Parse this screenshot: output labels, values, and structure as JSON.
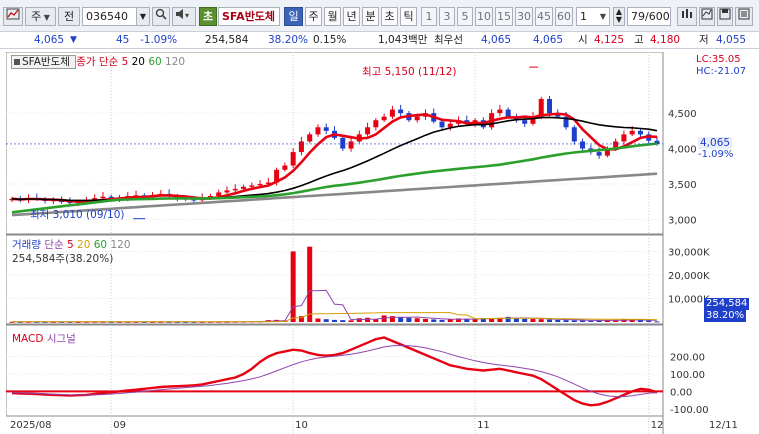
{
  "toolbar": {
    "market_short": "주",
    "mode": "전",
    "stock_code": "036540",
    "reset_label": "초",
    "stock_name": "SFA반도체",
    "periods": [
      "일",
      "주",
      "월",
      "년",
      "분",
      "초",
      "틱"
    ],
    "minute_options": [
      "1",
      "3",
      "5",
      "10",
      "15",
      "30",
      "45",
      "60"
    ],
    "interval_value": "1",
    "count_current": "79",
    "count_total": "/600"
  },
  "info": {
    "price": "4,065",
    "arrow": "▼",
    "change": "45",
    "change_pct": "-1.09%",
    "volume": "254,584",
    "volume_ratio": "38.20%",
    "turnover": "0.15%",
    "amount": "1,043백만",
    "mode_label": "최우선",
    "ask": "4,065",
    "bid": "4,065",
    "open_label": "시",
    "open": "4,125",
    "high_label": "고",
    "high": "4,180",
    "low_label": "저",
    "low": "4,055"
  },
  "price_panel": {
    "name_tag": "SFA반도체",
    "legend_title": "종가 단순",
    "ma_periods": [
      "5",
      "20",
      "60",
      "120"
    ],
    "lc_label": "LC:35.05",
    "hc_label": "HC:-21.07",
    "current_price": "4,065",
    "current_change": "-1.09%",
    "high_marker": "최고 5,150 (11/12)",
    "low_marker": "최저 3,010 (09/10)",
    "y_ticks": [
      "4,500",
      "4,000",
      "3,500",
      "3,000"
    ]
  },
  "volume_panel": {
    "legend_title": "거래량",
    "legend_type": "단순",
    "ma_periods": [
      "5",
      "20",
      "60",
      "120"
    ],
    "volume_text": "254,584주(38.20%)",
    "y_ticks": [
      "30,000K",
      "20,000K",
      "10,000K"
    ],
    "current_volume": "254,584",
    "current_ratio": "38.20%"
  },
  "macd_panel": {
    "legend_macd": "MACD",
    "legend_signal": "시그널",
    "y_ticks": [
      "200.00",
      "100.00",
      "0.00",
      "-100.00"
    ]
  },
  "x_axis": {
    "labels": [
      "2025/08",
      "09",
      "10",
      "11",
      "12",
      "12/11"
    ]
  },
  "chart_data": [
    {
      "type": "line",
      "title": "SFA반도체",
      "x_labels": [
        "2025/08",
        "09",
        "10",
        "11",
        "12"
      ],
      "close": [
        3290,
        3275,
        3300,
        3285,
        3260,
        3270,
        3245,
        3230,
        3250,
        3275,
        3300,
        3320,
        3280,
        3300,
        3330,
        3340,
        3320,
        3345,
        3360,
        3330,
        3300,
        3280,
        3270,
        3300,
        3330,
        3380,
        3410,
        3430,
        3460,
        3480,
        3500,
        3520,
        3700,
        3760,
        3950,
        4100,
        4200,
        4300,
        4250,
        4150,
        4000,
        4100,
        4200,
        4300,
        4400,
        4450,
        4550,
        4500,
        4400,
        4450,
        4500,
        4380,
        4300,
        4350,
        4400,
        4350,
        4400,
        4300,
        4500,
        4550,
        4450,
        4400,
        4350,
        4450,
        4700,
        4500,
        4450,
        4300,
        4100,
        4000,
        3950,
        3900,
        4000,
        4100,
        4200,
        4250,
        4200,
        4110,
        4065
      ],
      "ma_series": [
        {
          "name": "5",
          "color": "#e60012"
        },
        {
          "name": "20",
          "color": "#000000"
        },
        {
          "name": "60",
          "color": "#2ca02c"
        },
        {
          "name": "120",
          "color": "#888888"
        }
      ],
      "ylim": [
        2850,
        5250
      ],
      "high": {
        "value": 5150,
        "date": "11/12"
      },
      "low": {
        "value": 3010,
        "date": "09/10"
      }
    },
    {
      "type": "bar",
      "title": "거래량",
      "unit": "K",
      "values": [
        80,
        70,
        90,
        75,
        60,
        65,
        70,
        80,
        60,
        85,
        100,
        90,
        70,
        75,
        80,
        70,
        60,
        65,
        80,
        70,
        60,
        55,
        50,
        60,
        90,
        120,
        100,
        140,
        170,
        200,
        250,
        800,
        900,
        700,
        30000,
        2500,
        32000,
        1500,
        1200,
        900,
        800,
        700,
        1600,
        1800,
        1200,
        2800,
        2500,
        2000,
        1800,
        1600,
        1300,
        1100,
        900,
        1200,
        1500,
        1400,
        1200,
        1600,
        1500,
        1800,
        2200,
        1500,
        1400,
        1300,
        1200,
        1000,
        900,
        800,
        700,
        600,
        500,
        700,
        800,
        900,
        1000,
        800,
        700,
        600,
        254.584
      ],
      "ylim": [
        0,
        34000
      ]
    },
    {
      "type": "line",
      "title": "MACD",
      "series": [
        {
          "name": "MACD",
          "color": "#e60012",
          "values": [
            -10,
            -12,
            -13,
            -15,
            -18,
            -20,
            -22,
            -24,
            -22,
            -20,
            -15,
            -10,
            -5,
            0,
            5,
            10,
            15,
            20,
            25,
            28,
            30,
            32,
            35,
            40,
            50,
            60,
            70,
            80,
            100,
            130,
            170,
            200,
            220,
            230,
            240,
            235,
            220,
            210,
            205,
            210,
            220,
            240,
            260,
            280,
            300,
            310,
            290,
            270,
            250,
            230,
            210,
            190,
            170,
            150,
            140,
            130,
            125,
            120,
            125,
            130,
            120,
            110,
            100,
            90,
            70,
            40,
            10,
            -20,
            -50,
            -70,
            -80,
            -75,
            -60,
            -40,
            -20,
            0,
            15,
            10,
            -5
          ]
        },
        {
          "name": "시그널",
          "color": "#8e44ad",
          "values": [
            -5,
            -8,
            -10,
            -12,
            -14,
            -16,
            -18,
            -20,
            -21,
            -21,
            -20,
            -18,
            -15,
            -12,
            -8,
            -4,
            0,
            5,
            10,
            14,
            18,
            22,
            26,
            30,
            34,
            40,
            46,
            54,
            62,
            72,
            84,
            100,
            118,
            136,
            154,
            170,
            182,
            192,
            198,
            202,
            208,
            214,
            222,
            232,
            244,
            256,
            262,
            264,
            262,
            258,
            250,
            240,
            228,
            214,
            200,
            188,
            176,
            166,
            158,
            152,
            146,
            140,
            132,
            124,
            114,
            100,
            84,
            64,
            42,
            20,
            0,
            -15,
            -25,
            -30,
            -30,
            -25,
            -18,
            -10,
            -8
          ]
        }
      ],
      "ylim": [
        -130,
        330
      ]
    }
  ]
}
